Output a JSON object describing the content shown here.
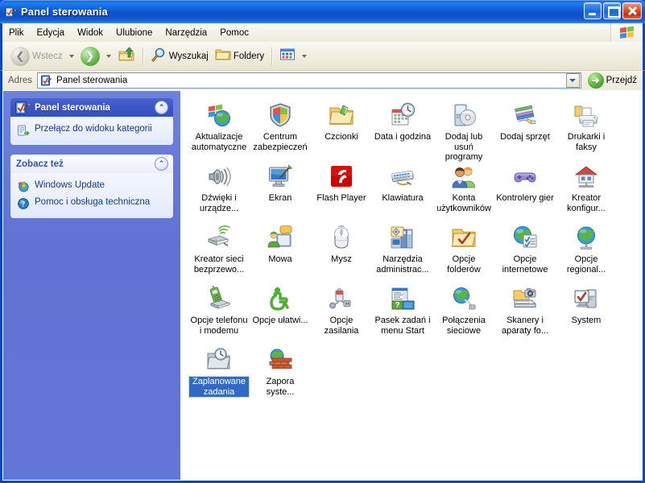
{
  "window": {
    "title": "Panel sterowania",
    "titlebar_icon": "control-panel-icon",
    "minimize_label": "Minimalizuj",
    "maximize_label": "Maksymalizuj",
    "close_label": "Zamknij"
  },
  "menubar": {
    "items": [
      {
        "label": "Plik"
      },
      {
        "label": "Edycja"
      },
      {
        "label": "Widok"
      },
      {
        "label": "Ulubione"
      },
      {
        "label": "Narzędzia"
      },
      {
        "label": "Pomoc"
      }
    ],
    "brand_icon": "windows-flag-icon"
  },
  "toolbar": {
    "back_label": "Wstecz",
    "back_icon": "back-arrow-icon",
    "back_dropdown_icon": "chevron-down-icon",
    "forward_icon": "forward-arrow-icon",
    "forward_dropdown_icon": "chevron-down-icon",
    "up_icon": "up-folder-icon",
    "search_label": "Wyszukaj",
    "search_icon": "magnifier-icon",
    "folders_label": "Foldery",
    "folders_icon": "folder-icon",
    "views_icon": "views-icon",
    "views_dropdown_icon": "chevron-down-icon"
  },
  "address": {
    "label": "Adres",
    "icon": "control-panel-icon",
    "value": "Panel sterowania",
    "placeholder": "Panel sterowania",
    "dropdown_icon": "chevron-down-icon",
    "go_label": "Przejdź",
    "go_icon": "green-arrow-right-icon"
  },
  "sidebar": {
    "panels": [
      {
        "title": "Panel sterowania",
        "style": "dark",
        "header_icon": "control-panel-icon",
        "collapse_icon": "chevron-up-icon",
        "links": [
          {
            "label": "Przełącz do widoku kategorii",
            "icon": "category-view-icon"
          }
        ]
      },
      {
        "title": "Zobacz też",
        "style": "light",
        "collapse_icon": "chevron-up-icon",
        "links": [
          {
            "label": "Windows Update",
            "icon": "windows-update-icon"
          },
          {
            "label": "Pomoc i obsługa techniczna",
            "icon": "help-question-icon"
          }
        ]
      }
    ]
  },
  "content": {
    "items": [
      {
        "label": "Aktualizacje automatyczne",
        "icon": "automatic-updates-icon",
        "selected": false
      },
      {
        "label": "Centrum zabezpieczeń",
        "icon": "security-center-shield-icon",
        "selected": false
      },
      {
        "label": "Czcionki",
        "icon": "fonts-folder-icon",
        "selected": false
      },
      {
        "label": "Data i godzina",
        "icon": "date-time-icon",
        "selected": false
      },
      {
        "label": "Dodaj lub usuń programy",
        "icon": "add-remove-programs-icon",
        "selected": false
      },
      {
        "label": "Dodaj sprzęt",
        "icon": "add-hardware-icon",
        "selected": false
      },
      {
        "label": "Drukarki i faksy",
        "icon": "printers-faxes-icon",
        "selected": false
      },
      {
        "label": "Dźwięki i urządze...",
        "icon": "sounds-audio-icon",
        "selected": false
      },
      {
        "label": "Ekran",
        "icon": "display-icon",
        "selected": false
      },
      {
        "label": "Flash Player",
        "icon": "flash-player-icon",
        "selected": false
      },
      {
        "label": "Klawiatura",
        "icon": "keyboard-icon",
        "selected": false
      },
      {
        "label": "Konta użytkowników",
        "icon": "user-accounts-icon",
        "selected": false
      },
      {
        "label": "Kontrolery gier",
        "icon": "game-controllers-icon",
        "selected": false
      },
      {
        "label": "Kreator konfigur...",
        "icon": "network-setup-wizard-icon",
        "selected": false
      },
      {
        "label": "Kreator sieci bezprzewo...",
        "icon": "wireless-network-wizard-icon",
        "selected": false
      },
      {
        "label": "Mowa",
        "icon": "speech-icon",
        "selected": false
      },
      {
        "label": "Mysz",
        "icon": "mouse-icon",
        "selected": false
      },
      {
        "label": "Narzędzia administrac...",
        "icon": "administrative-tools-icon",
        "selected": false
      },
      {
        "label": "Opcje folderów",
        "icon": "folder-options-icon",
        "selected": false
      },
      {
        "label": "Opcje internetowe",
        "icon": "internet-options-icon",
        "selected": false
      },
      {
        "label": "Opcje regional...",
        "icon": "regional-options-icon",
        "selected": false
      },
      {
        "label": "Opcje telefonu i modemu",
        "icon": "phone-modem-icon",
        "selected": false
      },
      {
        "label": "Opcje ułatwi...",
        "icon": "accessibility-options-icon",
        "selected": false
      },
      {
        "label": "Opcje zasilania",
        "icon": "power-options-icon",
        "selected": false
      },
      {
        "label": "Pasek zadań i menu Start",
        "icon": "taskbar-start-menu-icon",
        "selected": false
      },
      {
        "label": "Połączenia sieciowe",
        "icon": "network-connections-icon",
        "selected": false
      },
      {
        "label": "Skanery i aparaty fo...",
        "icon": "scanners-cameras-icon",
        "selected": false
      },
      {
        "label": "System",
        "icon": "system-icon",
        "selected": false
      },
      {
        "label": "Zaplanowane zadania",
        "icon": "scheduled-tasks-icon",
        "selected": true
      },
      {
        "label": "Zapora syste...",
        "icon": "firewall-icon",
        "selected": false
      }
    ]
  },
  "colors": {
    "titlebar_blue": "#0A46C4",
    "sidebar_blue": "#6375D6",
    "panel_header_dark": "#3C55C6",
    "panel_body": "#EAEFFC",
    "link_blue": "#15389B",
    "selection_blue": "#316AC5",
    "toolbar_beige": "#F1EFE2",
    "content_white": "#FFFFFF"
  }
}
